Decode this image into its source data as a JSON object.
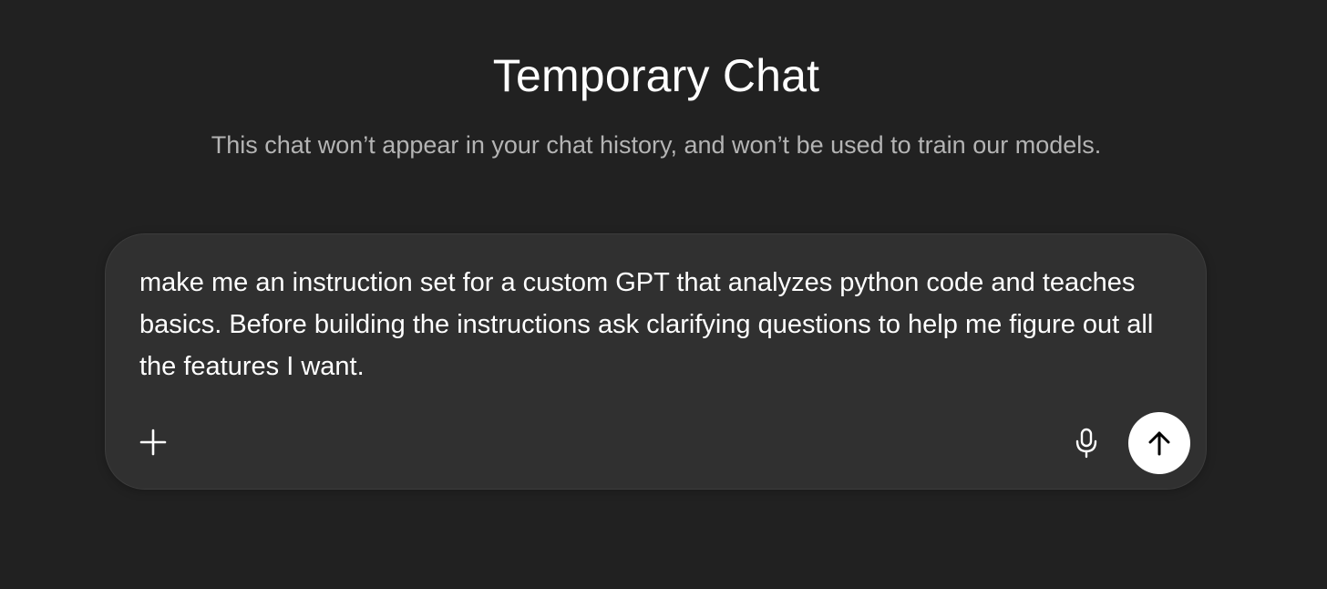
{
  "header": {
    "title": "Temporary Chat",
    "subtitle": "This chat won’t appear in your chat history, and won’t be used to train our models."
  },
  "composer": {
    "value": "make me an instruction set for a custom GPT that analyzes python code and teaches basics. Before building the instructions ask clarifying questions to help me figure out all the features I want.",
    "buttons": {
      "attach_icon": "plus-icon",
      "voice_icon": "microphone-icon",
      "send_icon": "arrow-up-icon"
    }
  },
  "colors": {
    "background": "#212121",
    "composer_background": "#303030",
    "text_primary": "#ffffff",
    "text_secondary": "#b4b4b4",
    "send_button": "#ffffff",
    "send_icon": "#000000"
  }
}
